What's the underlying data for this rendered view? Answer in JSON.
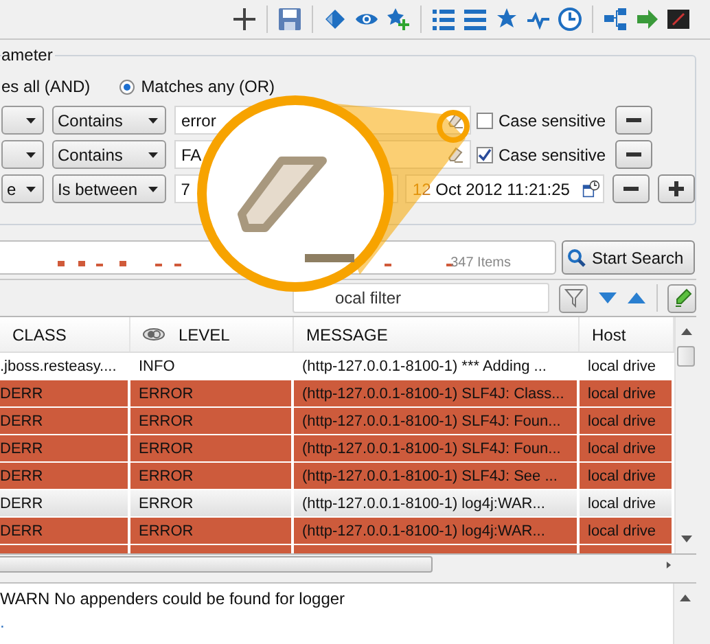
{
  "parameter_group": {
    "title": "ameter",
    "match_all_label": "es all (AND)",
    "match_any": {
      "label": "Matches any (OR)",
      "selected": true
    },
    "conditions": [
      {
        "kind": "text",
        "operator": "Contains",
        "value": "error",
        "case_sensitive": false,
        "case_label": "Case sensitive"
      },
      {
        "kind": "text",
        "operator": "Contains",
        "value": "FA",
        "case_sensitive": true,
        "case_label": "Case sensitive"
      },
      {
        "kind": "date",
        "field": "e",
        "operator": "Is between",
        "value": "7",
        "end_day": "12",
        "end_rest": "Oct 2012 11:21:25"
      }
    ]
  },
  "histogram": {
    "count": "347 Items"
  },
  "search_button": "Start Search",
  "filter": {
    "placeholder": "ocal filter"
  },
  "table": {
    "columns": [
      "CLASS",
      "LEVEL",
      "MESSAGE",
      "Host"
    ],
    "rows": [
      {
        "kind": "info",
        "selected": false,
        "class": ".jboss.resteasy....",
        "level": "INFO",
        "message": "(http-127.0.0.1-8100-1) *** Adding ...",
        "host": "local drive"
      },
      {
        "kind": "error",
        "selected": false,
        "class": "DERR",
        "level": "ERROR",
        "message": "(http-127.0.0.1-8100-1) SLF4J: Class...",
        "host": "local drive"
      },
      {
        "kind": "error",
        "selected": false,
        "class": "DERR",
        "level": "ERROR",
        "message": "(http-127.0.0.1-8100-1) SLF4J: Foun...",
        "host": "local drive"
      },
      {
        "kind": "error",
        "selected": false,
        "class": "DERR",
        "level": "ERROR",
        "message": "(http-127.0.0.1-8100-1) SLF4J: Foun...",
        "host": "local drive"
      },
      {
        "kind": "error",
        "selected": false,
        "class": "DERR",
        "level": "ERROR",
        "message": "(http-127.0.0.1-8100-1) SLF4J: See ...",
        "host": "local drive"
      },
      {
        "kind": "error",
        "selected": true,
        "class": "DERR",
        "level": "ERROR",
        "message": "(http-127.0.0.1-8100-1) log4j:WAR...",
        "host": "local drive"
      },
      {
        "kind": "error",
        "selected": false,
        "class": "DERR",
        "level": "ERROR",
        "message": "(http-127.0.0.1-8100-1) log4j:WAR...",
        "host": "local drive"
      },
      {
        "kind": "error",
        "selected": false
      }
    ]
  },
  "log_output": {
    "lines": [
      "WARN No appenders could be found for logger",
      "."
    ]
  }
}
